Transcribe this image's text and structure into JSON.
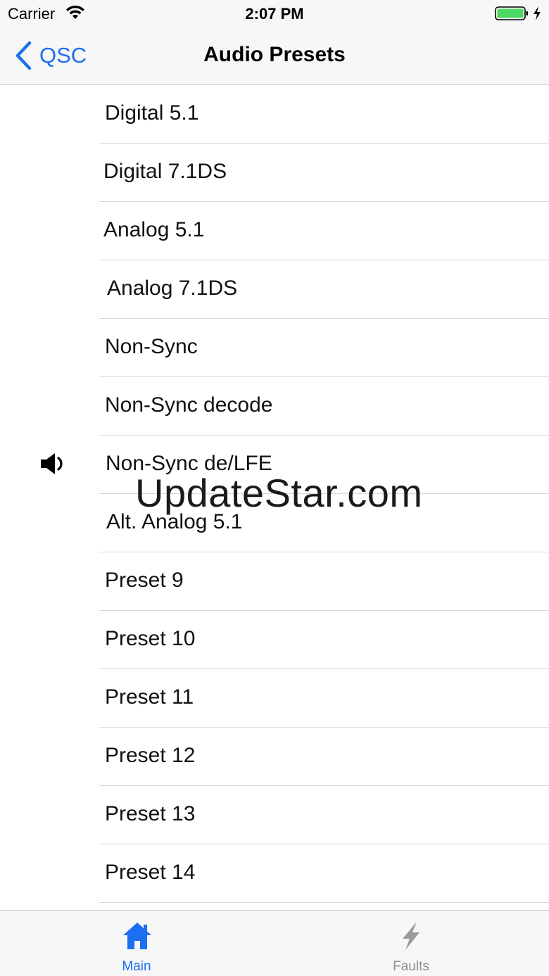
{
  "status_bar": {
    "carrier": "Carrier",
    "time": "2:07 PM",
    "battery_color": "#4cd964"
  },
  "nav": {
    "back_label": "QSC",
    "title": "Audio Presets",
    "accent_color": "#1b6ff0"
  },
  "presets": [
    {
      "label": "Digital 5.1"
    },
    {
      "label": "Digital 7.1DS"
    },
    {
      "label": "Analog 5.1"
    },
    {
      "label": "Analog 7.1DS"
    },
    {
      "label": "Non-Sync"
    },
    {
      "label": "Non-Sync decode"
    },
    {
      "label": "Non-Sync de/LFE",
      "active": true,
      "icon": "speaker-icon"
    },
    {
      "label": "Alt. Analog 5.1"
    },
    {
      "label": "Preset 9"
    },
    {
      "label": "Preset 10"
    },
    {
      "label": "Preset 11"
    },
    {
      "label": "Preset 12"
    },
    {
      "label": "Preset 13"
    },
    {
      "label": "Preset 14"
    }
  ],
  "watermark": "UpdateStar.com",
  "tabs": [
    {
      "label": "Main",
      "icon": "home-icon",
      "selected": true
    },
    {
      "label": "Faults",
      "icon": "lightning-icon",
      "selected": false
    }
  ]
}
